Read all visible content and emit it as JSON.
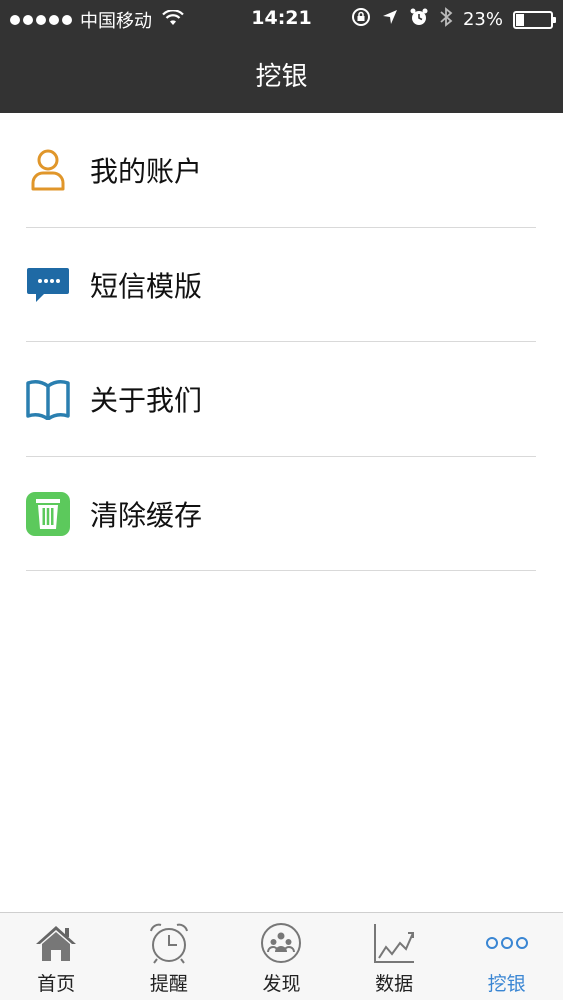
{
  "status_bar": {
    "carrier": "中国移动",
    "time": "14:21",
    "battery": "23%",
    "battery_level": 0.23
  },
  "header": {
    "title": "挖银"
  },
  "menu": {
    "items": [
      {
        "label": "我的账户",
        "icon": "user-icon",
        "color": "#e0962a"
      },
      {
        "label": "短信模版",
        "icon": "message-icon",
        "color": "#1f6aa5"
      },
      {
        "label": "关于我们",
        "icon": "book-icon",
        "color": "#2a7fb0"
      },
      {
        "label": "清除缓存",
        "icon": "trash-icon",
        "color": "#5cc95c"
      }
    ]
  },
  "tabbar": {
    "items": [
      {
        "label": "首页",
        "icon": "home-icon"
      },
      {
        "label": "提醒",
        "icon": "alarm-clock-icon"
      },
      {
        "label": "发现",
        "icon": "discover-people-icon"
      },
      {
        "label": "数据",
        "icon": "line-chart-icon"
      },
      {
        "label": "挖银",
        "icon": "more-dots-icon",
        "active": true
      }
    ],
    "active_color": "#3a86d3"
  }
}
